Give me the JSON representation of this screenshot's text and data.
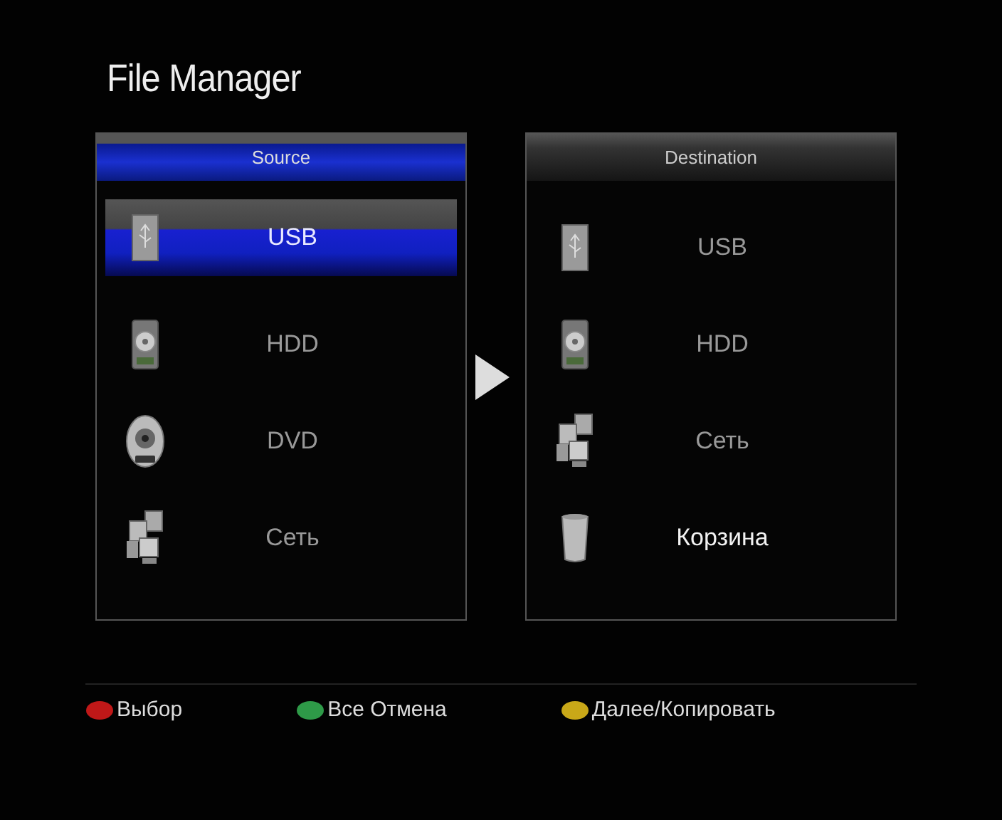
{
  "title": "File Manager",
  "source": {
    "header": "Source",
    "selected": true,
    "items": [
      {
        "kind": "usb",
        "label": "USB",
        "selected": true
      },
      {
        "kind": "hdd",
        "label": "HDD",
        "selected": false
      },
      {
        "kind": "dvd",
        "label": "DVD",
        "selected": false
      },
      {
        "kind": "network",
        "label": "Сеть",
        "selected": false
      }
    ]
  },
  "destination": {
    "header": "Destination",
    "selected": false,
    "items": [
      {
        "kind": "usb",
        "label": "USB",
        "selected": false
      },
      {
        "kind": "hdd",
        "label": "HDD",
        "selected": false
      },
      {
        "kind": "network",
        "label": "Сеть",
        "selected": false
      },
      {
        "kind": "trash",
        "label": "Корзина",
        "selected": true
      }
    ]
  },
  "legend": [
    {
      "label": "Выбор",
      "color": "#c01818"
    },
    {
      "label": "Все Отмена",
      "color": "#2e9a48"
    },
    {
      "label": "Далее/Копировать",
      "color": "#c9a818"
    }
  ]
}
